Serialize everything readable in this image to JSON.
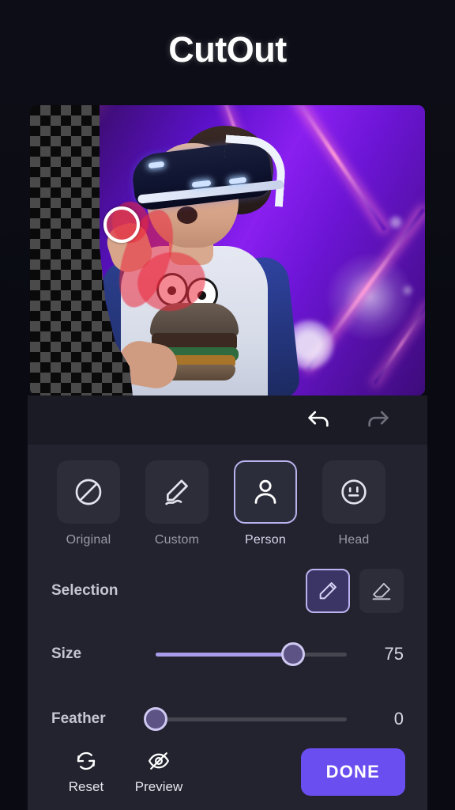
{
  "header": {
    "title": "CutOut"
  },
  "canvas": {
    "undo_icon": "undo-arrow-icon",
    "redo_icon": "redo-arrow-icon",
    "brush_cursor_color": "#e13c4b",
    "checkerboard_colors": [
      "#4a4a4a",
      "#0a0a0a"
    ],
    "photo_description": "person-wearing-vr-headset"
  },
  "tools": {
    "items": [
      {
        "label": "Original",
        "icon": "circle-slash-icon",
        "active": false
      },
      {
        "label": "Custom",
        "icon": "pencil-underline-icon",
        "active": false
      },
      {
        "label": "Person",
        "icon": "person-icon",
        "active": true
      },
      {
        "label": "Head",
        "icon": "face-smile-icon",
        "active": false
      }
    ]
  },
  "selection": {
    "label": "Selection",
    "modes": [
      {
        "name": "brush",
        "icon": "pencil-icon",
        "active": true
      },
      {
        "name": "erase",
        "icon": "eraser-icon",
        "active": false
      }
    ]
  },
  "sliders": [
    {
      "label": "Size",
      "value": 75,
      "value_text": "75",
      "percent": 72
    },
    {
      "label": "Feather",
      "value": 0,
      "value_text": "0",
      "percent": 0
    }
  ],
  "bottom": {
    "reset": {
      "label": "Reset",
      "icon": "refresh-cycle-icon"
    },
    "preview": {
      "label": "Preview",
      "icon": "eye-slash-icon"
    },
    "done_label": "DONE"
  },
  "colors": {
    "accent": "#6b4ef0",
    "accent_light": "#a99ce8",
    "border_active": "#b9b3ef",
    "panel": "#22232e",
    "panel_dark": "#1a1b24",
    "background": "#0a0b12"
  }
}
